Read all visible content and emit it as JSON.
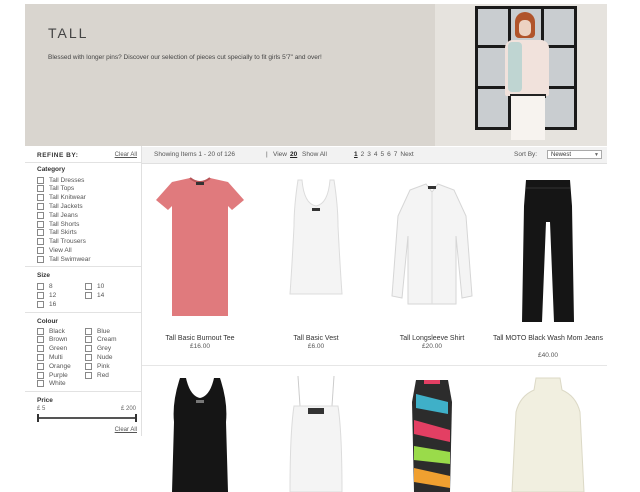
{
  "banner": {
    "title": "TALL",
    "description": "Blessed with longer pins? Discover our selection of pieces cut specially to fit girls 5'7\" and over!"
  },
  "sidebar": {
    "refine_label": "REFINE BY:",
    "clear_all": "Clear All",
    "category": {
      "heading": "Category",
      "items": [
        "Tall Dresses",
        "Tall Tops",
        "Tall Knitwear",
        "Tall Jackets",
        "Tall Jeans",
        "Tall Shorts",
        "Tall Skirts",
        "Tall Trousers",
        "View All",
        "Tall Swimwear"
      ]
    },
    "size": {
      "heading": "Size",
      "col1": [
        "8",
        "12",
        "16"
      ],
      "col2": [
        "10",
        "14"
      ]
    },
    "colour": {
      "heading": "Colour",
      "col1": [
        "Black",
        "Brown",
        "Green",
        "Multi",
        "Orange",
        "Purple",
        "White"
      ],
      "col2": [
        "Blue",
        "Cream",
        "Grey",
        "Nude",
        "Pink",
        "Red"
      ]
    },
    "price": {
      "heading": "Price",
      "min": "£ 5",
      "max": "£ 200"
    },
    "clear_all_bottom": "Clear All"
  },
  "toolbar": {
    "showing": "Showing Items 1 - 20 of 126",
    "separator": "|",
    "view_label": "View",
    "view_20": "20",
    "show_all": "Show All",
    "pages": [
      "1",
      "2",
      "3",
      "4",
      "5",
      "6",
      "7"
    ],
    "active_page": "1",
    "next": "Next",
    "sort_label": "Sort By:",
    "sort_value": "Newest"
  },
  "products": [
    {
      "name": "Tall Basic Burnout Tee",
      "price": "£16.00",
      "icon": "burnout-tee-image",
      "color": "#e07a7d"
    },
    {
      "name": "Tall Basic Vest",
      "price": "£6.00",
      "icon": "white-vest-image",
      "color": "#f4f4f4"
    },
    {
      "name": "Tall Longsleeve Shirt",
      "price": "£20.00",
      "icon": "white-shirt-image",
      "color": "#f4f4f4"
    },
    {
      "name": "Tall MOTO Black Wash Mom Jeans",
      "price": "£40.00",
      "icon": "black-jeans-image",
      "color": "#151515"
    },
    {
      "name": "",
      "price": "",
      "icon": "black-vest-dress-image",
      "color": "#151515"
    },
    {
      "name": "",
      "price": "",
      "icon": "white-cami-image",
      "color": "#f4f4f4"
    },
    {
      "name": "",
      "price": "",
      "icon": "printed-dress-image",
      "color": "#cc3355"
    },
    {
      "name": "",
      "price": "",
      "icon": "cream-top-image",
      "color": "#f1efe0"
    }
  ]
}
